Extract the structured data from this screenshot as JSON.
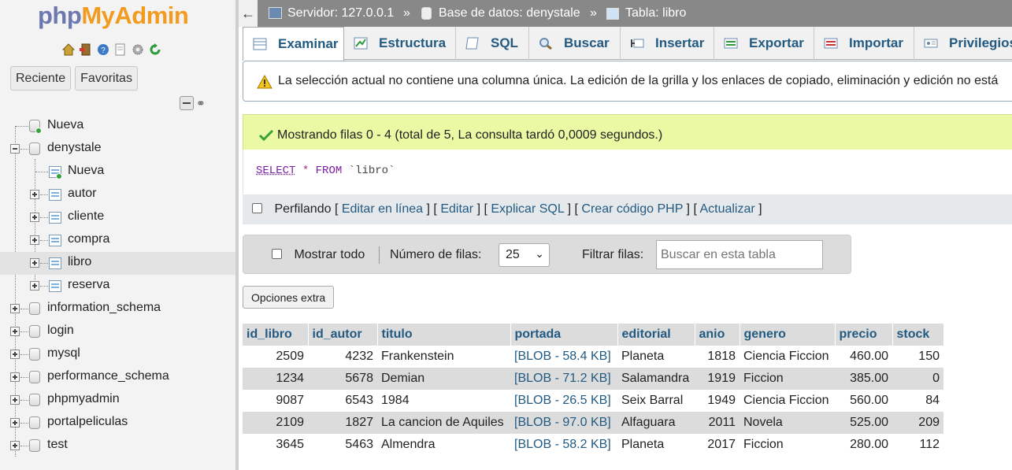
{
  "logo": {
    "part1": "php",
    "part2": "MyAdmin"
  },
  "sidebar": {
    "tabs": [
      "Reciente",
      "Favoritas"
    ],
    "quick_icons": [
      "home-icon",
      "exit-icon",
      "help-icon",
      "docs-icon",
      "settings-icon",
      "reload-icon"
    ],
    "tree": {
      "new": "Nueva",
      "db": "denystale",
      "db_new": "Nueva",
      "tables": [
        "autor",
        "cliente",
        "compra",
        "libro",
        "reserva"
      ],
      "active_table": "libro",
      "other_dbs": [
        "information_schema",
        "login",
        "mysql",
        "performance_schema",
        "phpmyadmin",
        "portalpeliculas",
        "test"
      ]
    }
  },
  "breadcrumb": {
    "server": "Servidor: 127.0.0.1",
    "database": "Base de datos: denystale",
    "table": "Tabla: libro",
    "sep": "»"
  },
  "menu": {
    "tabs": [
      "Examinar",
      "Estructura",
      "SQL",
      "Buscar",
      "Insertar",
      "Exportar",
      "Importar",
      "Privilegios"
    ],
    "active": "Examinar"
  },
  "warning": "La selección actual no contiene una columna única. La edición de la grilla y los enlaces de copiado, eliminación y edición no está",
  "success": "Mostrando filas 0 - 4 (total de 5, La consulta tardó 0,0009 segundos.)",
  "sql": {
    "select": "SELECT",
    "star": "*",
    "from": "FROM",
    "table": "`libro`"
  },
  "profiling": {
    "label": "Perfilando",
    "links": [
      "Editar en línea",
      "Editar",
      "Explicar SQL",
      "Crear código PHP",
      "Actualizar"
    ],
    "open": "[",
    "close": "]"
  },
  "nav": {
    "show_all": "Mostrar todo",
    "rows_label": "Número de filas:",
    "rows_value": "25",
    "filter_label": "Filtrar filas:",
    "filter_placeholder": "Buscar en esta tabla"
  },
  "extra_options": "Opciones extra",
  "table": {
    "columns": [
      "id_libro",
      "id_autor",
      "titulo",
      "portada",
      "editorial",
      "anio",
      "genero",
      "precio",
      "stock"
    ],
    "rows": [
      [
        "2509",
        "4232",
        "Frankenstein",
        "[BLOB - 58.4 KB]",
        "Planeta",
        "1818",
        "Ciencia Ficcion",
        "460.00",
        "150"
      ],
      [
        "1234",
        "5678",
        "Demian",
        "[BLOB - 71.2 KB]",
        "Salamandra",
        "1919",
        "Ficcion",
        "385.00",
        "0"
      ],
      [
        "9087",
        "6543",
        "1984",
        "[BLOB - 26.5 KB]",
        "Seix Barral",
        "1949",
        "Ciencia Ficcion",
        "560.00",
        "84"
      ],
      [
        "2109",
        "1827",
        "La cancion de Aquiles",
        "[BLOB - 97.0 KB]",
        "Alfaguara",
        "2011",
        "Novela",
        "525.00",
        "209"
      ],
      [
        "3645",
        "5463",
        "Almendra",
        "[BLOB - 58.2 KB]",
        "Planeta",
        "2017",
        "Ficcion",
        "280.00",
        "112"
      ]
    ]
  }
}
